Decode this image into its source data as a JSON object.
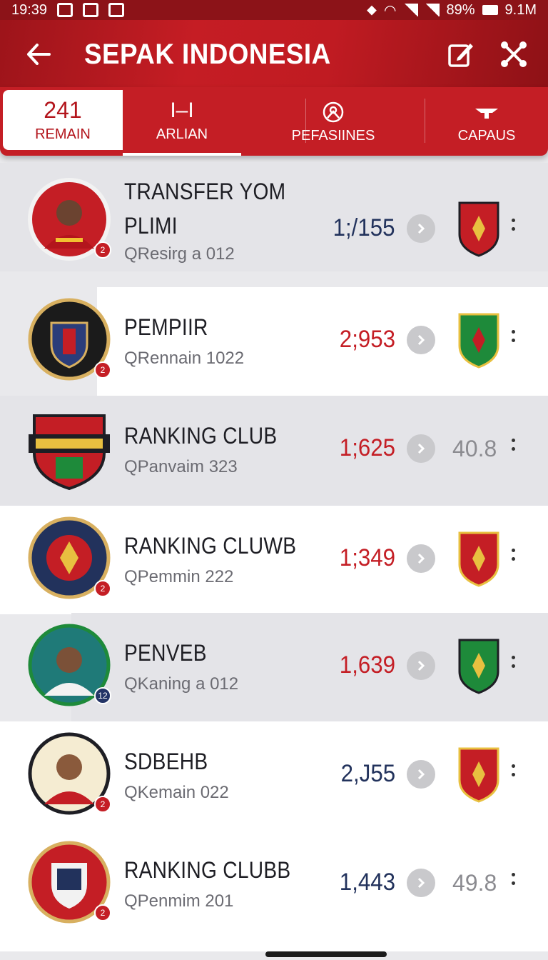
{
  "status": {
    "time": "19:39",
    "battery": "89%",
    "data": "9.1M"
  },
  "header": {
    "title": "SEPAK INDONESIA"
  },
  "tabs": [
    {
      "top": "241",
      "label": "REMAIN"
    },
    {
      "top": "I–I",
      "label": "ARLIAN"
    },
    {
      "label": "PEFASIINES"
    },
    {
      "label": "CAPAUS"
    }
  ],
  "rows": [
    {
      "name1": "TRANSFER YOM",
      "name2": "PLIMI",
      "sub": "QResirg a 012",
      "score": "1;/155",
      "score_color": "navy",
      "crest": "red",
      "avatar_kind": "player",
      "badge": "2"
    },
    {
      "name1": "PEMPIIR",
      "name2": "",
      "sub": "QRennain 1022",
      "score": "2;953",
      "score_color": "red",
      "crest": "green",
      "avatar_kind": "club-dark",
      "badge": "2"
    },
    {
      "name1": "RANKING CLUB",
      "name2": "",
      "sub": "QPanvaim 323",
      "score": "1;625",
      "score_color": "red",
      "rating": "40.8",
      "avatar_kind": "club-shield"
    },
    {
      "name1": "RANKING CLUWB",
      "name2": "",
      "sub": "QPemmin 222",
      "score": "1;349",
      "score_color": "red",
      "crest": "red",
      "avatar_kind": "club-navy",
      "badge": "2"
    },
    {
      "name1": "PENVEB",
      "name2": "",
      "sub": "QKaning a 012",
      "score": "1,639",
      "score_color": "red",
      "crest": "green",
      "avatar_kind": "player-teal",
      "badge": "12"
    },
    {
      "name1": "SDBEHB",
      "name2": "",
      "sub": "QKemain 022",
      "score": "2,J55",
      "score_color": "navy",
      "crest": "red",
      "avatar_kind": "player-cream",
      "badge": "2"
    },
    {
      "name1": "RANKING CLUBB",
      "name2": "",
      "sub": "QPenmim 201",
      "score": "1,443",
      "score_color": "navy",
      "rating": "49.8",
      "avatar_kind": "club-red",
      "badge": "2"
    }
  ],
  "colors": {
    "primary_red": "#c41e25",
    "navy": "#22325c",
    "crest_green": "#1e8a3a"
  }
}
